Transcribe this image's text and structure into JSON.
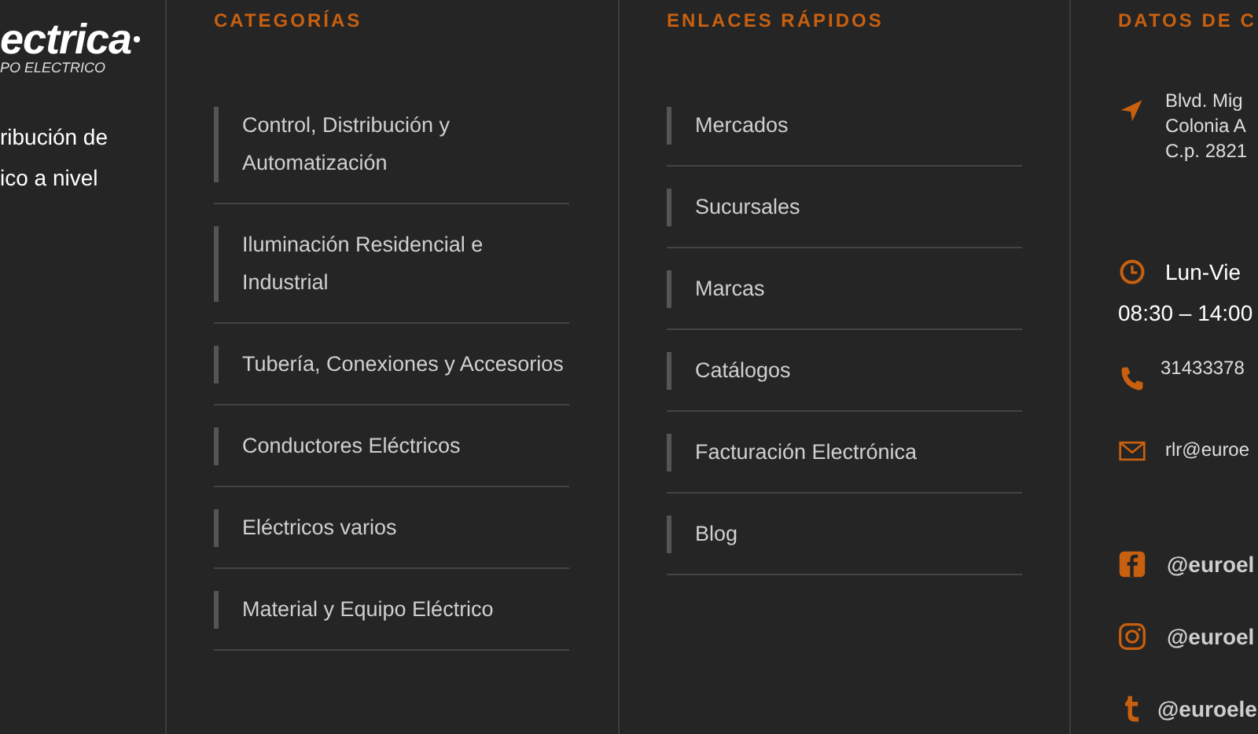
{
  "brand": {
    "logo_text": "ectrica",
    "tagline": "PO ELECTRICO",
    "description_lines": [
      "ribución de",
      "ico a nivel"
    ]
  },
  "categories": {
    "title": "CATEGORÍAS",
    "items": [
      {
        "label": "Control, Distribución y Automatización"
      },
      {
        "label": "Iluminación Residencial e Industrial"
      },
      {
        "label": "Tubería, Conexiones y Accesorios"
      },
      {
        "label": "Conductores Eléctricos"
      },
      {
        "label": "Eléctricos varios"
      },
      {
        "label": "Material y Equipo Eléctrico"
      }
    ]
  },
  "quick_links": {
    "title": "ENLACES RÁPIDOS",
    "items": [
      {
        "label": "Mercados"
      },
      {
        "label": "Sucursales"
      },
      {
        "label": "Marcas"
      },
      {
        "label": "Catálogos"
      },
      {
        "label": "Facturación Electrónica"
      },
      {
        "label": "Blog"
      }
    ]
  },
  "contact": {
    "title": "DATOS DE C",
    "entries": [
      {
        "kind": "address",
        "lines": [
          "Blvd. Mig",
          "Colonia A",
          "C.p. 2821"
        ]
      },
      {
        "kind": "hours",
        "lines": [
          "Lun-Vie",
          "08:30 – 14:00"
        ]
      },
      {
        "kind": "phone",
        "lines": [
          "31433378"
        ]
      },
      {
        "kind": "email",
        "lines": [
          "rlr@euroe"
        ]
      }
    ],
    "social": [
      {
        "kind": "facebook",
        "handle": "@euroel"
      },
      {
        "kind": "instagram",
        "handle": "@euroel"
      },
      {
        "kind": "tumblr",
        "handle": "@euroele"
      }
    ]
  }
}
